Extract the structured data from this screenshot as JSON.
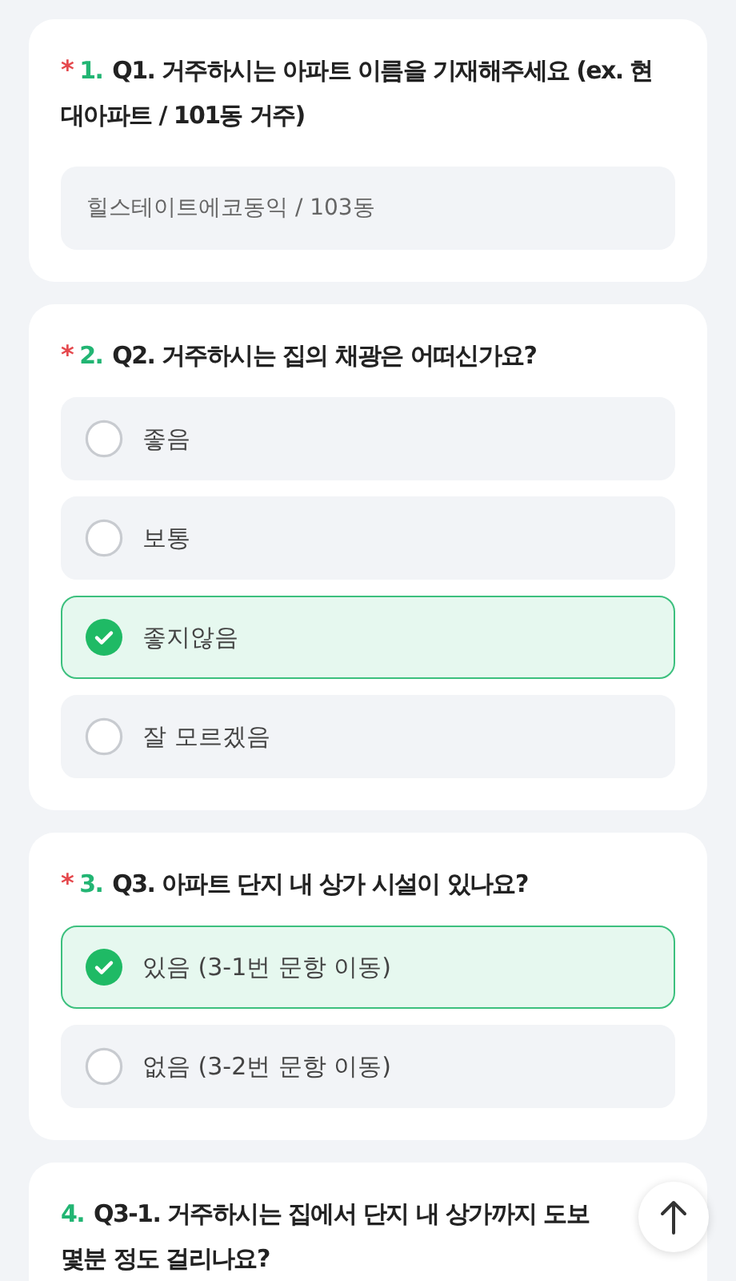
{
  "questions": [
    {
      "mark": "*",
      "number": "1.",
      "title": [
        "Q1. 거주하시는 아파트 이름을 기재해주세요 (ex. 현대아파트 / 101동 거주)"
      ],
      "kind": "text",
      "value": "힐스테이트에코동익 / 103동"
    },
    {
      "mark": "*",
      "number": "2.",
      "title": [
        "Q2. 거주하시는 집의 채광은 어떠신가요?"
      ],
      "kind": "choice",
      "options": [
        {
          "label": "좋음",
          "selected": false
        },
        {
          "label": "보통",
          "selected": false
        },
        {
          "label": "좋지않음",
          "selected": true
        },
        {
          "label": "잘 모르겠음",
          "selected": false
        }
      ]
    },
    {
      "mark": "*",
      "number": "3.",
      "title": [
        "Q3. 아파트 단지 내 상가 시설이 있나요?"
      ],
      "kind": "choice",
      "options": [
        {
          "label": "있음 (3-1번 문항 이동)",
          "selected": true
        },
        {
          "label": "없음 (3-2번 문항 이동)",
          "selected": false
        }
      ]
    },
    {
      "number": "4.",
      "title": [
        "Q3-1. 거주하시는 집에서 단지 내 상가까지 도보",
        "몇분 정도 걸리나요?"
      ],
      "kind": "choice"
    }
  ]
}
